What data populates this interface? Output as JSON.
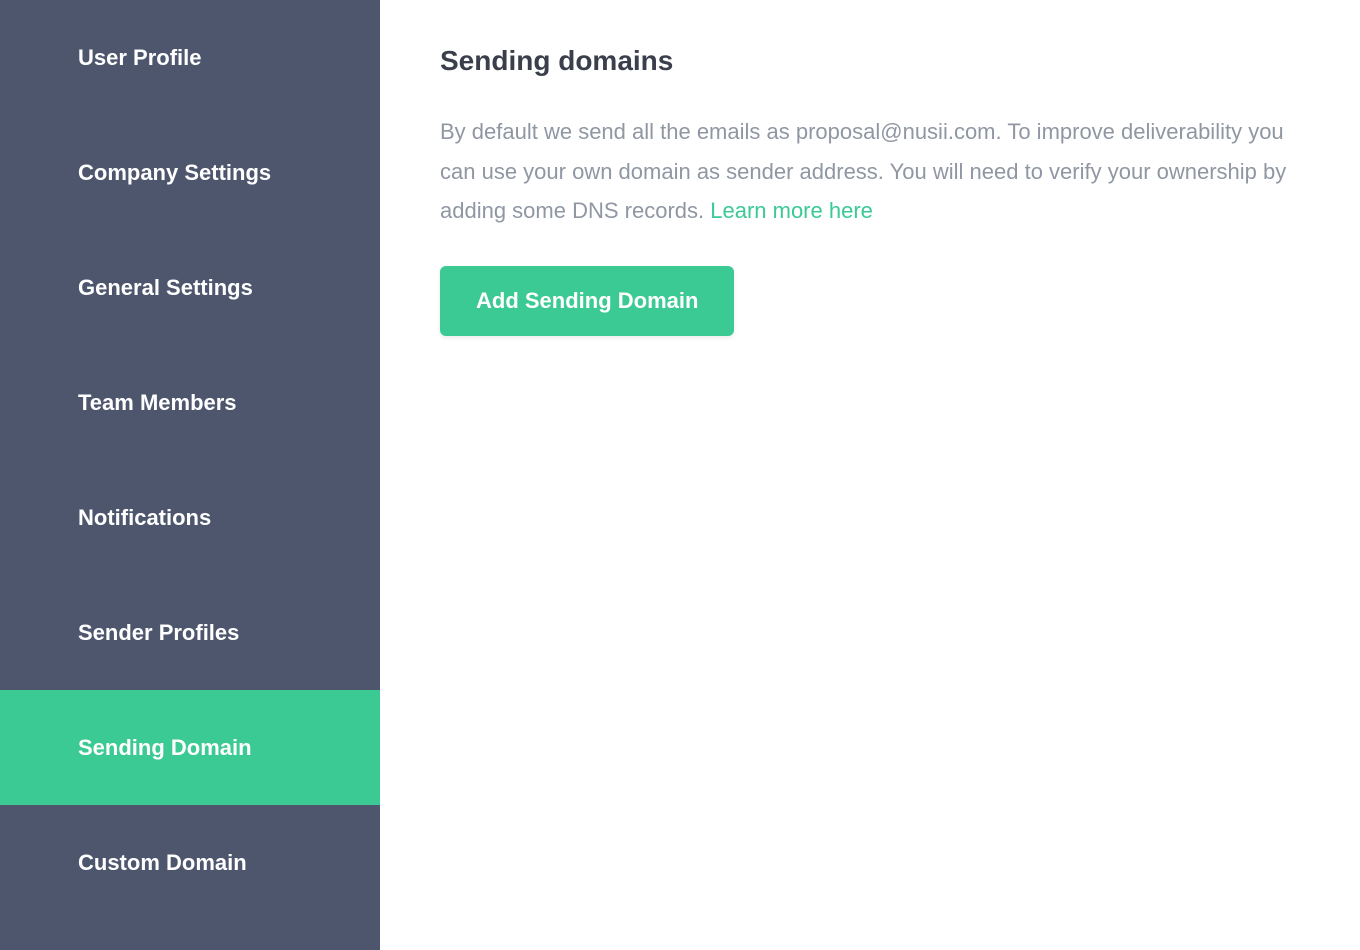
{
  "sidebar": {
    "items": [
      {
        "label": "User Profile",
        "active": false
      },
      {
        "label": "Company Settings",
        "active": false
      },
      {
        "label": "General Settings",
        "active": false
      },
      {
        "label": "Team Members",
        "active": false
      },
      {
        "label": "Notifications",
        "active": false
      },
      {
        "label": "Sender Profiles",
        "active": false
      },
      {
        "label": "Sending Domain",
        "active": true
      },
      {
        "label": "Custom Domain",
        "active": false
      }
    ]
  },
  "main": {
    "title": "Sending domains",
    "description_text": "By default we send all the emails as proposal@nusii.com. To improve deliverability you can use your own domain as sender address. You will need to verify your ownership by adding some DNS records. ",
    "learn_more_label": "Learn more here",
    "add_button_label": "Add Sending Domain"
  },
  "colors": {
    "sidebar_bg": "#4d566d",
    "accent": "#3bc994",
    "text_dark": "#3a3f4b",
    "text_muted": "#9097a3"
  }
}
